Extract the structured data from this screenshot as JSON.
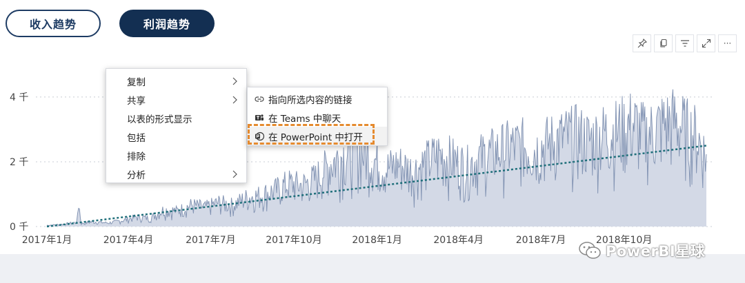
{
  "tabs": [
    {
      "label": "收入趋势",
      "active": false
    },
    {
      "label": "利润趋势",
      "active": true
    }
  ],
  "toolbar": {
    "icons": [
      "pin-icon",
      "copy-icon",
      "filter-icon",
      "expand-icon",
      "more-icon"
    ],
    "more_label": "···"
  },
  "context_menu": {
    "items": [
      {
        "label": "复制",
        "has_submenu": true
      },
      {
        "label": "共享",
        "has_submenu": true
      },
      {
        "label": "以表的形式显示",
        "has_submenu": false
      },
      {
        "label": "包括",
        "has_submenu": false
      },
      {
        "label": "排除",
        "has_submenu": false
      },
      {
        "label": "分析",
        "has_submenu": true
      }
    ]
  },
  "share_submenu": {
    "items": [
      {
        "label": "指向所选内容的链接",
        "icon": "link-icon"
      },
      {
        "label": "在 Teams 中聊天",
        "icon": "teams-icon"
      },
      {
        "label": "在 PowerPoint 中打开",
        "icon": "powerpoint-icon",
        "highlighted": true
      }
    ]
  },
  "watermark": "PowerBI星球",
  "colors": {
    "area_fill": "#d3d9e6",
    "line": "#8495b4",
    "trend": "#1f6f7a",
    "tab_active": "#132f52",
    "highlight_box": "#e58a2e"
  },
  "chart_data": {
    "type": "area",
    "y_ticks": [
      "0 千",
      "2 千",
      "4 千"
    ],
    "y_tick_values": [
      0,
      2000,
      4000
    ],
    "ylim": [
      0,
      4700
    ],
    "x_ticks": [
      "2017年1月",
      "2017年4月",
      "2017年7月",
      "2017年10月",
      "2018年1月",
      "2018年4月",
      "2018年7月",
      "2018年10月"
    ],
    "x_range": [
      "2017-01-01",
      "2018-12-31"
    ],
    "grid": true,
    "trend_line": {
      "start": 0,
      "end": 2500
    },
    "series": [
      {
        "granularity": "daily (approximate envelope)",
        "points": [
          [
            "2017-01-01",
            50
          ],
          [
            "2017-01-20",
            100
          ],
          [
            "2017-02-03",
            180
          ],
          [
            "2017-02-05",
            1000
          ],
          [
            "2017-02-08",
            120
          ],
          [
            "2017-02-20",
            200
          ],
          [
            "2017-03-10",
            150
          ],
          [
            "2017-03-25",
            250
          ],
          [
            "2017-04-10",
            400
          ],
          [
            "2017-04-25",
            350
          ],
          [
            "2017-05-10",
            700
          ],
          [
            "2017-05-25",
            650
          ],
          [
            "2017-06-10",
            900
          ],
          [
            "2017-06-25",
            800
          ],
          [
            "2017-07-10",
            1000
          ],
          [
            "2017-07-25",
            900
          ],
          [
            "2017-08-10",
            1200
          ],
          [
            "2017-08-25",
            1300
          ],
          [
            "2017-09-10",
            1500
          ],
          [
            "2017-09-25",
            1800
          ],
          [
            "2017-10-10",
            1700
          ],
          [
            "2017-10-25",
            2000
          ],
          [
            "2017-11-10",
            2600
          ],
          [
            "2017-11-25",
            3000
          ],
          [
            "2017-12-10",
            3200
          ],
          [
            "2017-12-25",
            2900
          ],
          [
            "2018-01-10",
            2400
          ],
          [
            "2018-01-25",
            2600
          ],
          [
            "2018-02-10",
            2300
          ],
          [
            "2018-02-25",
            2700
          ],
          [
            "2018-03-10",
            3000
          ],
          [
            "2018-03-25",
            2800
          ],
          [
            "2018-04-10",
            2500
          ],
          [
            "2018-04-25",
            2900
          ],
          [
            "2018-05-10",
            3100
          ],
          [
            "2018-05-25",
            3300
          ],
          [
            "2018-06-10",
            3400
          ],
          [
            "2018-06-25",
            3200
          ],
          [
            "2018-07-10",
            3500
          ],
          [
            "2018-07-25",
            3700
          ],
          [
            "2018-08-10",
            3800
          ],
          [
            "2018-08-25",
            3600
          ],
          [
            "2018-09-10",
            3900
          ],
          [
            "2018-09-25",
            4000
          ],
          [
            "2018-10-10",
            4300
          ],
          [
            "2018-10-25",
            3800
          ],
          [
            "2018-11-10",
            4200
          ],
          [
            "2018-11-25",
            4400
          ],
          [
            "2018-12-10",
            4000
          ],
          [
            "2018-12-20",
            3800
          ],
          [
            "2018-12-31",
            2900
          ]
        ]
      }
    ]
  }
}
